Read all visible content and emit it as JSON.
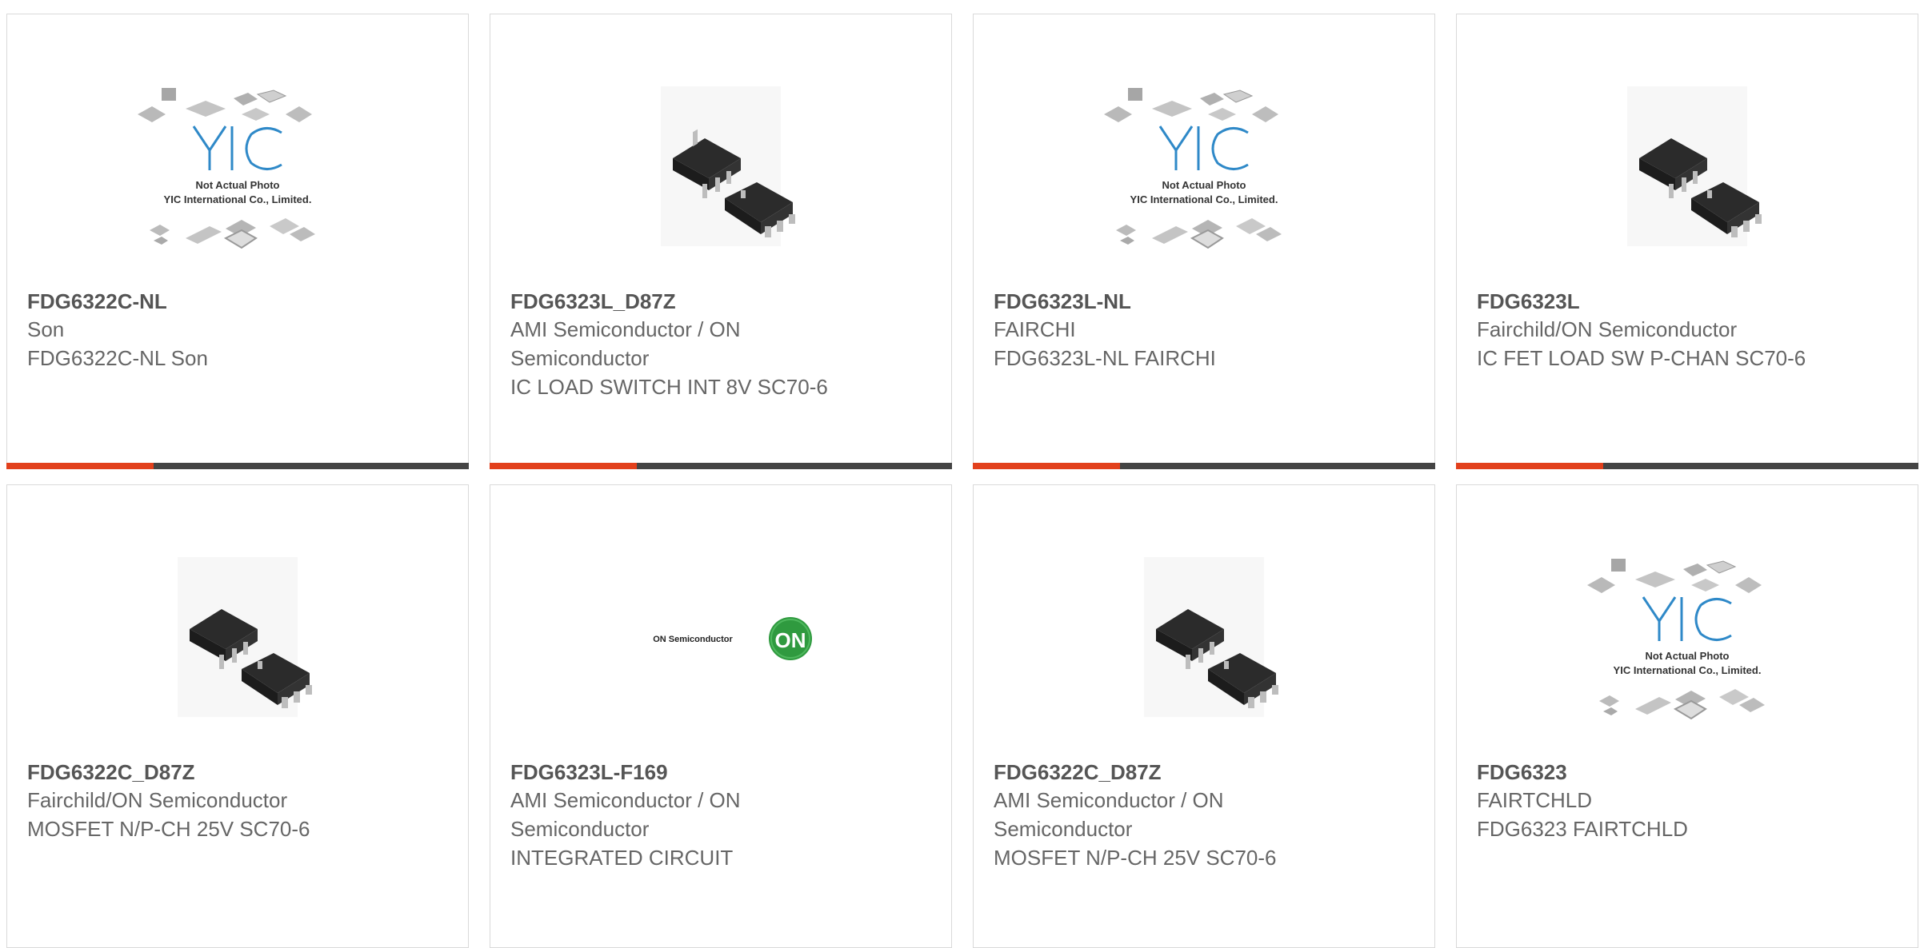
{
  "products": [
    {
      "part_number": "FDG6322C-NL",
      "manufacturer": "Son",
      "description": "FDG6322C-NL Son",
      "image": "yic-placeholder",
      "placeholder_lines": [
        "Not Actual Photo",
        "YIC International Co., Limited."
      ],
      "logo_text": "YIC"
    },
    {
      "part_number": "FDG6323L_D87Z",
      "manufacturer": "AMI Semiconductor / ON Semiconductor",
      "description": "IC LOAD SWITCH INT 8V SC70-6",
      "image": "sc70-chip-photo"
    },
    {
      "part_number": "FDG6323L-NL",
      "manufacturer": "FAIRCHI",
      "description": "FDG6323L-NL FAIRCHI",
      "image": "yic-placeholder",
      "placeholder_lines": [
        "Not Actual Photo",
        "YIC International Co., Limited."
      ],
      "logo_text": "YIC"
    },
    {
      "part_number": "FDG6323L",
      "manufacturer": "Fairchild/ON Semiconductor",
      "description": "IC FET LOAD SW P-CHAN SC70-6",
      "image": "sc70-chip-photo"
    },
    {
      "part_number": "FDG6322C_D87Z",
      "manufacturer": "Fairchild/ON Semiconductor",
      "description": "MOSFET N/P-CH 25V SC70-6",
      "image": "sc70-chip-photo"
    },
    {
      "part_number": "FDG6323L-F169",
      "manufacturer": "AMI Semiconductor / ON Semiconductor",
      "description": "INTEGRATED CIRCUIT",
      "image": "on-semiconductor-logo",
      "logo_wordmark": "ON Semiconductor",
      "logo_badge": "ON"
    },
    {
      "part_number": "FDG6322C_D87Z",
      "manufacturer": "AMI Semiconductor / ON Semiconductor",
      "description": "MOSFET N/P-CH 25V SC70-6",
      "image": "sc70-chip-photo"
    },
    {
      "part_number": "FDG6323",
      "manufacturer": "FAIRTCHLD",
      "description": "FDG6323 FAIRTCHLD",
      "image": "yic-placeholder",
      "placeholder_lines": [
        "Not Actual Photo",
        "YIC International Co., Limited."
      ],
      "logo_text": "YIC"
    }
  ],
  "colors": {
    "accent": "#e2401c",
    "bar": "#444444",
    "title": "#555555",
    "text": "#666666",
    "on_green": "#2f9a3f"
  }
}
